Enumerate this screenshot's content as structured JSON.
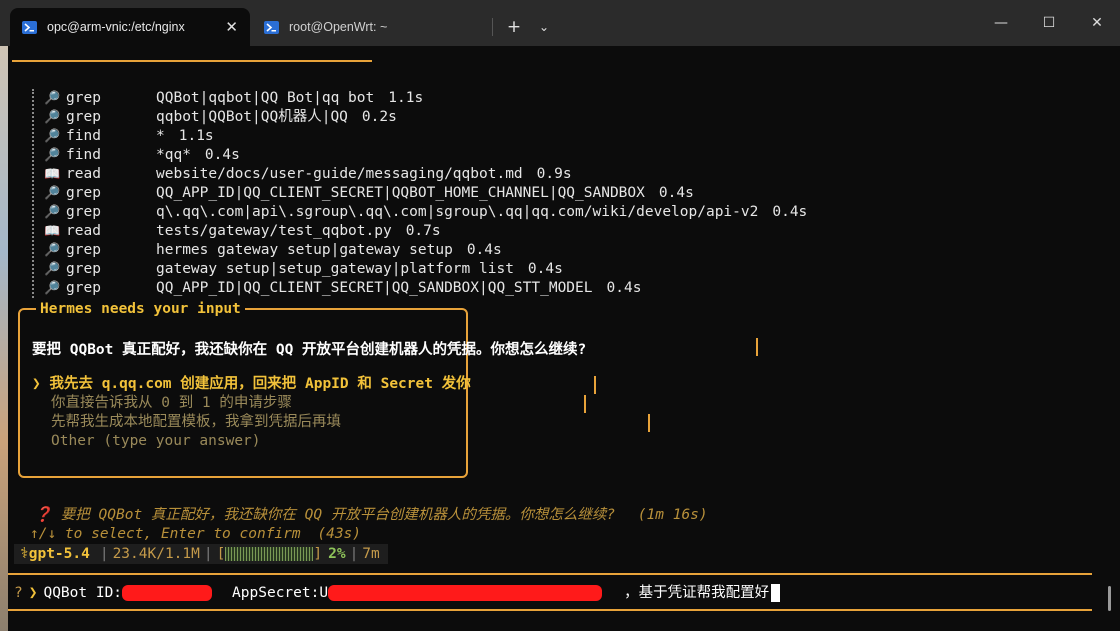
{
  "window": {
    "controls": {
      "minimize": "—",
      "maximize": "☐",
      "close": "✕"
    }
  },
  "tabs": [
    {
      "label": "opc@arm-vnic:/etc/nginx",
      "icon": "powershell-icon",
      "active": true,
      "close": "✕"
    },
    {
      "label": "root@OpenWrt: ~",
      "icon": "powershell-icon",
      "active": false
    }
  ],
  "tabbar": {
    "new_tab": "+",
    "dropdown": "⌄"
  },
  "log": [
    {
      "icon": "🔎",
      "verb": "grep",
      "arg": "QQBot|qqbot|QQ Bot|qq bot",
      "time": "1.1s"
    },
    {
      "icon": "🔎",
      "verb": "grep",
      "arg": "qqbot|QQBot|QQ机器人|QQ",
      "time": "0.2s"
    },
    {
      "icon": "🔎",
      "verb": "find",
      "arg": "*",
      "time": "1.1s"
    },
    {
      "icon": "🔎",
      "verb": "find",
      "arg": "*qq*",
      "time": "0.4s"
    },
    {
      "icon": "📖",
      "verb": "read",
      "arg": "website/docs/user-guide/messaging/qqbot.md",
      "time": "0.9s"
    },
    {
      "icon": "🔎",
      "verb": "grep",
      "arg": "QQ_APP_ID|QQ_CLIENT_SECRET|QQBOT_HOME_CHANNEL|QQ_SANDBOX",
      "time": "0.4s"
    },
    {
      "icon": "🔎",
      "verb": "grep",
      "arg": "q\\.qq\\.com|api\\.sgroup\\.qq\\.com|sgroup\\.qq|qq.com/wiki/develop/api-v2",
      "time": "0.4s"
    },
    {
      "icon": "📖",
      "verb": "read",
      "arg": "tests/gateway/test_qqbot.py",
      "time": "0.7s"
    },
    {
      "icon": "🔎",
      "verb": "grep",
      "arg": "hermes gateway setup|gateway setup",
      "time": "0.4s"
    },
    {
      "icon": "🔎",
      "verb": "grep",
      "arg": "gateway setup|setup_gateway|platform list",
      "time": "0.4s"
    },
    {
      "icon": "🔎",
      "verb": "grep",
      "arg": "QQ_APP_ID|QQ_CLIENT_SECRET|QQ_SANDBOX|QQ_STT_MODEL",
      "time": "0.4s"
    }
  ],
  "panel": {
    "title": "Hermes needs your input",
    "question": "要把 QQBot 真正配好，我还缺你在 QQ 开放平台创建机器人的凭据。你想怎么继续?",
    "selected_marker": "❯",
    "options": [
      "我先去 q.qq.com 创建应用，回来把 AppID 和 Secret 发你",
      "你直接告诉我从 0 到 1 的申请步骤",
      "先帮我生成本地配置模板，我拿到凭据后再填",
      "Other (type your answer)"
    ]
  },
  "pending": {
    "icon": "❓",
    "text": "要把 QQBot 真正配好，我还缺你在 QQ 开放平台创建机器人的凭据。你想怎么继续?",
    "elapsed": "(1m 16s)"
  },
  "hint": {
    "text": "↑/↓ to select, Enter to confirm",
    "countdown": "(43s)"
  },
  "status": {
    "model": "⚕gpt-5.4",
    "tokens": "23.4K/1.1M",
    "bar_open": "[",
    "bar_close": "]",
    "context_fraction": 0.02,
    "percent": "2%",
    "duration": "7m",
    "sep": "|"
  },
  "input": {
    "question_mark": "?",
    "prompt": "❯",
    "id_label": "QQBot ID:",
    "secret_label": "AppSecret:",
    "secret_visible": "U",
    "tail": "，基于凭证帮我配置好"
  },
  "colors": {
    "accent": "#e8a33a",
    "highlight": "#f2c23a",
    "redaction": "#ff1a1a",
    "background": "#0c0c0c"
  }
}
